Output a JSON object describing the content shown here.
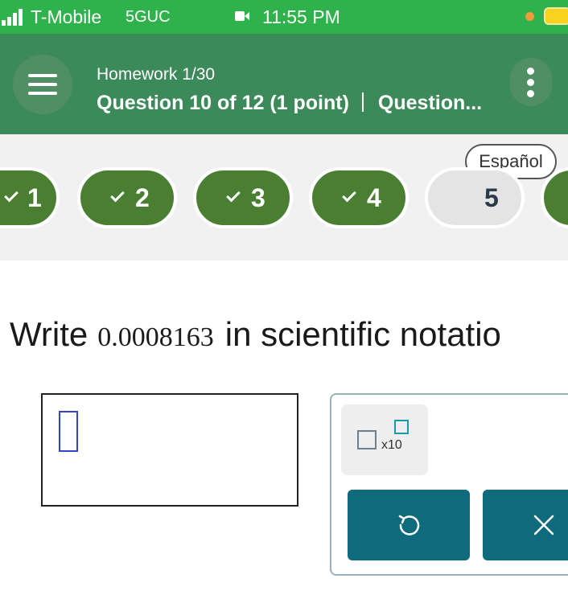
{
  "status_bar": {
    "carrier": "T-Mobile",
    "network": "5GUC",
    "time": "11:55 PM"
  },
  "header": {
    "homework": "Homework 1/30",
    "question_info": "Question 10 of 12 (1 point)",
    "question_tab": "Question..."
  },
  "language_button": "Español",
  "question_nav": [
    {
      "label": "1",
      "status": "complete"
    },
    {
      "label": "2",
      "status": "complete"
    },
    {
      "label": "3",
      "status": "complete"
    },
    {
      "label": "4",
      "status": "complete"
    },
    {
      "label": "5",
      "status": "current"
    }
  ],
  "question": {
    "prefix": "Write",
    "number": "0.0008163",
    "suffix": "in scientific notatio"
  },
  "palette": {
    "sci_notation_label": "x10",
    "undo_icon": "undo-icon",
    "clear_icon": "close-icon"
  },
  "colors": {
    "status_bar": "#2fb24b",
    "header": "#3c8a5a",
    "complete_pill": "#4a7f32",
    "palette_button": "#0e6a7c"
  }
}
